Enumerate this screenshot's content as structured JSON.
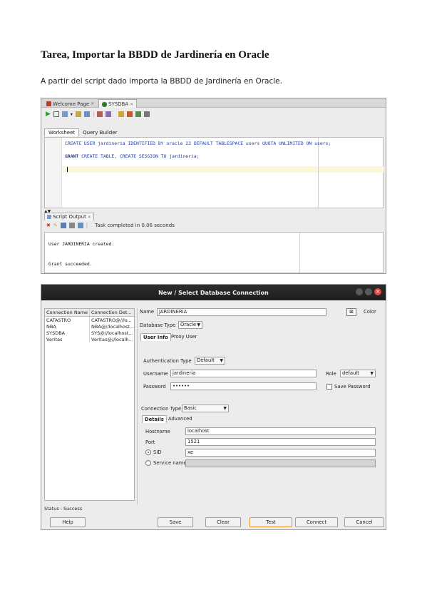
{
  "doc": {
    "title": "Tarea, Importar la BBDD de Jardinería en Oracle",
    "intro": "A partir del script dado importa la BBDD de Jardinería en Oracle."
  },
  "sqldev": {
    "tabs": [
      "Welcome Page",
      "SYSDBA"
    ],
    "subtabs": [
      "Worksheet",
      "Query Builder"
    ],
    "code_line1": "CREATE USER jardineria IDENTIFIED BY oracle 23 DEFAULT TABLESPACE users QUOTA UNLIMITED ON users;",
    "code_line2_kw": "GRANT",
    "code_line2_rest": " CREATE TABLE, CREATE SESSION TO jardineria;",
    "splitter": "▲▼",
    "output_tab": "Script Output",
    "output_status": "Task completed in 0.06 seconds",
    "output_line1": "User JARDINERIA created.",
    "output_line2": "Grant succeeded."
  },
  "dialog": {
    "title": "New / Select Database Connection",
    "columns": [
      "Connection Name",
      "Connection Det..."
    ],
    "connections": [
      [
        "CATASTRO",
        "CATASTRO@//lo..."
      ],
      [
        "NBA",
        "NBA@//localhost..."
      ],
      [
        "SYSDBA",
        "SYS@//localhost..."
      ],
      [
        "Veritas",
        "Veritas@//localh..."
      ]
    ],
    "status": "Status : Success",
    "name_label": "Name",
    "name_value": "JARDINERIA",
    "color_label": "Color",
    "db_type_label": "Database Type",
    "db_type_value": "Oracle",
    "tabs": [
      "User Info",
      "Proxy User"
    ],
    "auth_type_label": "Authentication Type",
    "auth_type_value": "Default",
    "username_label": "Username",
    "username_value": "jardineria",
    "role_label": "Role",
    "role_value": "default",
    "password_label": "Password",
    "password_value": "••••••",
    "save_password_label": "Save Password",
    "conn_type_label": "Connection Type",
    "conn_type_value": "Basic",
    "detail_tabs": [
      "Details",
      "Advanced"
    ],
    "hostname_label": "Hostname",
    "hostname_value": "localhost",
    "port_label": "Port",
    "port_value": "1521",
    "sid_label": "SID",
    "sid_value": "xe",
    "service_label": "Service name",
    "buttons": {
      "help": "Help",
      "save": "Save",
      "clear": "Clear",
      "test": "Test",
      "connect": "Connect",
      "cancel": "Cancel"
    }
  }
}
